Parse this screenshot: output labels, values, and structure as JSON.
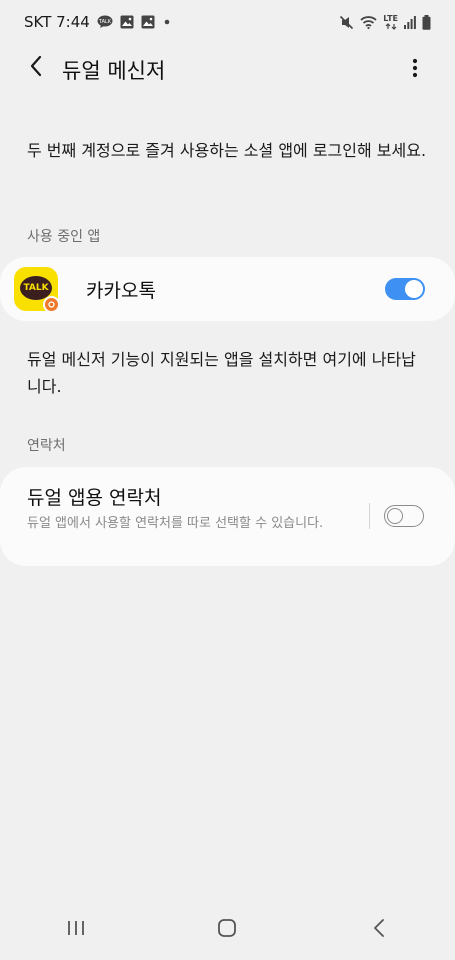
{
  "status_bar": {
    "carrier_time": "SKT 7:44",
    "left_icons": [
      "talk-notification-icon",
      "image-notification-icon",
      "image-notification-icon",
      "dot-icon"
    ],
    "right_icons": [
      "mute-icon",
      "wifi-icon",
      "lte-signal-icon",
      "signal-icon",
      "battery-icon"
    ],
    "lte_label": "LTE"
  },
  "header": {
    "title": "듀얼 메신저"
  },
  "description": "두 번째 계정으로 즐겨 사용하는 소셜 앱에 로그인해 보세요.",
  "in_use_section": {
    "label": "사용 중인 앱",
    "apps": [
      {
        "name": "카카오톡",
        "icon": "kakaotalk-icon",
        "icon_text": "TALK",
        "enabled": true
      }
    ]
  },
  "info_text": "듀얼 메신저 기능이 지원되는 앱을 설치하면 여기에 나타납니다.",
  "contacts_section": {
    "label": "연락처",
    "item": {
      "title": "듀얼 앱용 연락처",
      "subtitle": "듀얼 앱에서 사용할 연락처를 따로 선택할 수 있습니다.",
      "enabled": false
    }
  },
  "colors": {
    "background": "#f0f0f0",
    "card": "#fbfbfb",
    "accent": "#3e91f2",
    "kakao_yellow": "#f9e000"
  }
}
